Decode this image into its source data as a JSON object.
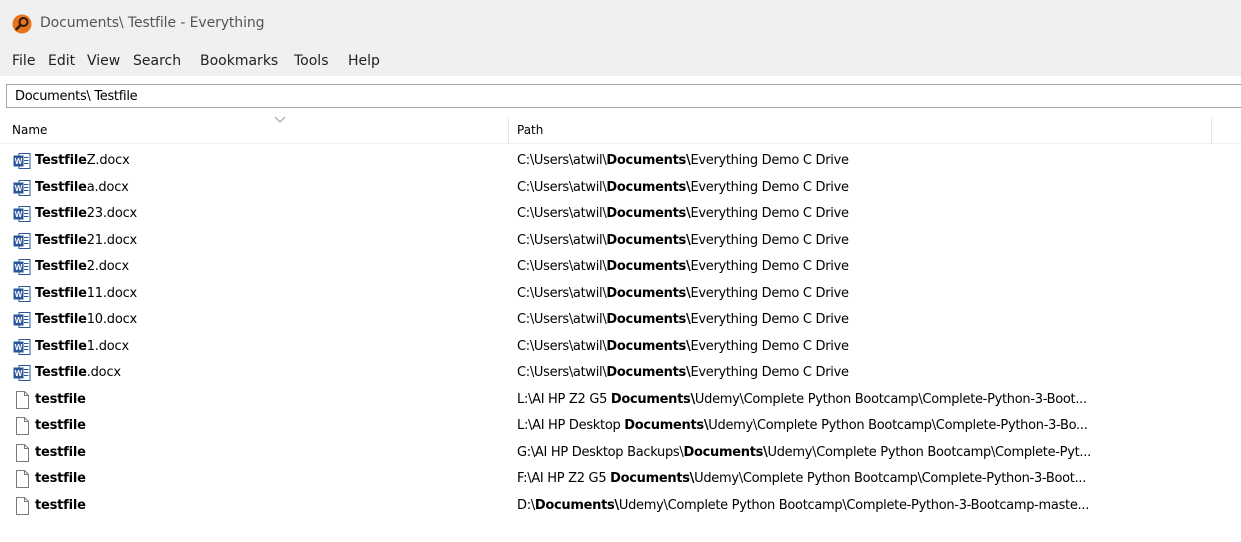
{
  "window": {
    "title": "Documents\\ Testfile - Everything",
    "app_icon": "everything-search-icon",
    "accent_color": "#e8731a"
  },
  "menu": [
    "File",
    "Edit",
    "View",
    "Search",
    "Bookmarks",
    "Tools",
    "Help"
  ],
  "search": {
    "value": "Documents\\ Testfile"
  },
  "columns": {
    "name": "Name",
    "path": "Path",
    "sort_indicator": "chevron-down-icon"
  },
  "rows": [
    {
      "icon": "word-document-icon",
      "name_bold": "Testfile",
      "name_rest": "Z.docx",
      "path_pre": "C:\\Users\\atwil\\",
      "path_bold": "Documents\\",
      "path_post": "Everything Demo C Drive"
    },
    {
      "icon": "word-document-icon",
      "name_bold": "Testfile",
      "name_rest": "a.docx",
      "path_pre": "C:\\Users\\atwil\\",
      "path_bold": "Documents\\",
      "path_post": "Everything Demo C Drive"
    },
    {
      "icon": "word-document-icon",
      "name_bold": "Testfile",
      "name_rest": "23.docx",
      "path_pre": "C:\\Users\\atwil\\",
      "path_bold": "Documents\\",
      "path_post": "Everything Demo C Drive"
    },
    {
      "icon": "word-document-icon",
      "name_bold": "Testfile",
      "name_rest": "21.docx",
      "path_pre": "C:\\Users\\atwil\\",
      "path_bold": "Documents\\",
      "path_post": "Everything Demo C Drive"
    },
    {
      "icon": "word-document-icon",
      "name_bold": "Testfile",
      "name_rest": "2.docx",
      "path_pre": "C:\\Users\\atwil\\",
      "path_bold": "Documents\\",
      "path_post": "Everything Demo C Drive"
    },
    {
      "icon": "word-document-icon",
      "name_bold": "Testfile",
      "name_rest": "11.docx",
      "path_pre": "C:\\Users\\atwil\\",
      "path_bold": "Documents\\",
      "path_post": "Everything Demo C Drive"
    },
    {
      "icon": "word-document-icon",
      "name_bold": "Testfile",
      "name_rest": "10.docx",
      "path_pre": "C:\\Users\\atwil\\",
      "path_bold": "Documents\\",
      "path_post": "Everything Demo C Drive"
    },
    {
      "icon": "word-document-icon",
      "name_bold": "Testfile",
      "name_rest": "1.docx",
      "path_pre": "C:\\Users\\atwil\\",
      "path_bold": "Documents\\",
      "path_post": "Everything Demo C Drive"
    },
    {
      "icon": "word-document-icon",
      "name_bold": "Testfile",
      "name_rest": ".docx",
      "path_pre": "C:\\Users\\atwil\\",
      "path_bold": "Documents\\",
      "path_post": "Everything Demo C Drive"
    },
    {
      "icon": "blank-file-icon",
      "name_bold": "testfile",
      "name_rest": "",
      "path_pre": "L:\\AI HP Z2 G5 ",
      "path_bold": "Documents\\",
      "path_post": "Udemy\\Complete Python Bootcamp\\Complete-Python-3-Boot..."
    },
    {
      "icon": "blank-file-icon",
      "name_bold": "testfile",
      "name_rest": "",
      "path_pre": "L:\\AI HP Desktop ",
      "path_bold": "Documents\\",
      "path_post": "Udemy\\Complete Python Bootcamp\\Complete-Python-3-Bo..."
    },
    {
      "icon": "blank-file-icon",
      "name_bold": "testfile",
      "name_rest": "",
      "path_pre": "G:\\AI HP Desktop Backups\\",
      "path_bold": "Documents\\",
      "path_post": "Udemy\\Complete Python Bootcamp\\Complete-Pyt..."
    },
    {
      "icon": "blank-file-icon",
      "name_bold": "testfile",
      "name_rest": "",
      "path_pre": "F:\\AI HP Z2 G5 ",
      "path_bold": "Documents\\",
      "path_post": "Udemy\\Complete Python Bootcamp\\Complete-Python-3-Boot..."
    },
    {
      "icon": "blank-file-icon",
      "name_bold": "testfile",
      "name_rest": "",
      "path_pre": "D:\\",
      "path_bold": "Documents\\",
      "path_post": "Udemy\\Complete Python Bootcamp\\Complete-Python-3-Bootcamp-maste..."
    }
  ]
}
